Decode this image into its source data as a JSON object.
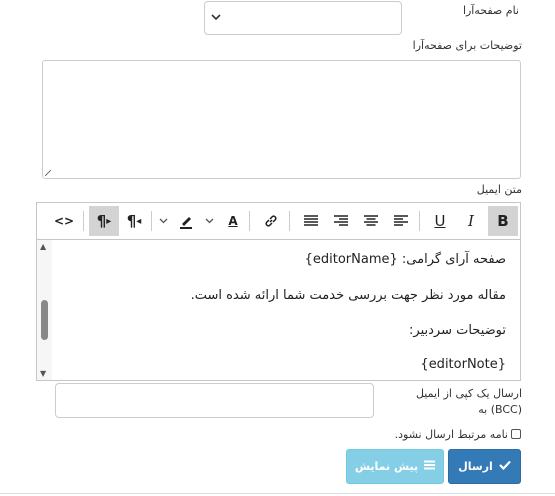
{
  "form": {
    "editor_name_label": "نام صفحه‌آرا",
    "notes_label": "توضیحات برای صفحه‌آرا",
    "email_body_label": "متن ایمیل",
    "bcc_label_line1": "ارسال یک کپی از ایمیل",
    "bcc_label_line2": "(BCC) به",
    "no_send_label": "نامه مرتبط ارسال نشود.",
    "send_button": "ارسال",
    "preview_button": "پیش نمایش"
  },
  "editor": {
    "toolbar": {
      "bold": "B",
      "italic": "I",
      "underline": "U",
      "ltr": "¶",
      "rtl": "¶",
      "source": "<>",
      "font_color": "A"
    },
    "lines": [
      "صفحه آرای گرامی: {editorName}",
      "مقاله مورد نظر جهت بررسی خدمت شما ارائه شده است.",
      "توضیحات سردبیر:",
      "{editorNote}"
    ]
  },
  "colors": {
    "primary": "#337ab7",
    "info": "#5bc0de"
  }
}
